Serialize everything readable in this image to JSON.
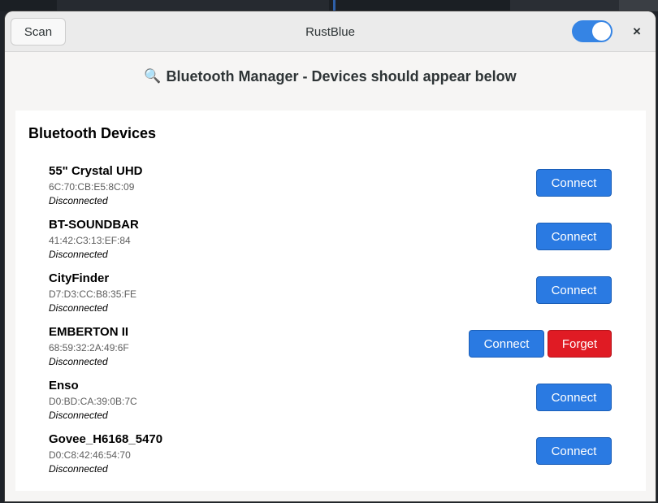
{
  "window": {
    "title": "RustBlue",
    "scan_label": "Scan",
    "close_label": "×",
    "bluetooth_enabled": true
  },
  "header": {
    "icon": "🔍",
    "text": "Bluetooth Manager - Devices should appear below"
  },
  "panel": {
    "title": "Bluetooth Devices"
  },
  "devices": [
    {
      "name": "55\" Crystal UHD",
      "mac": "6C:70:CB:E5:8C:09",
      "status": "Disconnected",
      "connect_label": "Connect"
    },
    {
      "name": "BT-SOUNDBAR",
      "mac": "41:42:C3:13:EF:84",
      "status": "Disconnected",
      "connect_label": "Connect"
    },
    {
      "name": "CityFinder",
      "mac": "D7:D3:CC:B8:35:FE",
      "status": "Disconnected",
      "connect_label": "Connect"
    },
    {
      "name": "EMBERTON II",
      "mac": "68:59:32:2A:49:6F",
      "status": "Disconnected",
      "connect_label": "Connect",
      "forget_label": "Forget"
    },
    {
      "name": "Enso",
      "mac": "D0:BD:CA:39:0B:7C",
      "status": "Disconnected",
      "connect_label": "Connect"
    },
    {
      "name": "Govee_H6168_5470",
      "mac": "D0:C8:42:46:54:70",
      "status": "Disconnected",
      "connect_label": "Connect"
    }
  ],
  "colors": {
    "accent": "#3584e4",
    "connect": "#2a7ae2",
    "forget": "#e01b24"
  }
}
